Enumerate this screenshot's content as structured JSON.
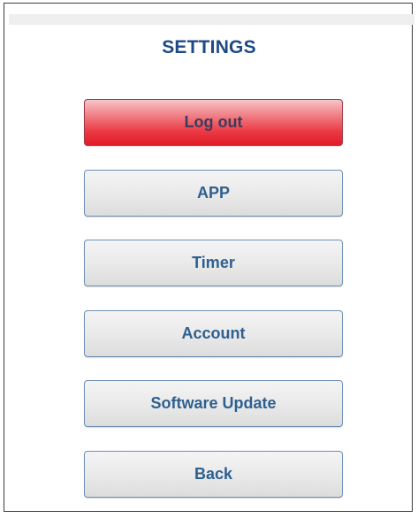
{
  "header": {
    "title": "SETTINGS"
  },
  "menu": {
    "items": [
      {
        "label": "Log out"
      },
      {
        "label": "APP"
      },
      {
        "label": "Timer"
      },
      {
        "label": "Account"
      },
      {
        "label": "Software Update"
      },
      {
        "label": "Back"
      }
    ]
  },
  "colors": {
    "title": "#1d4a86",
    "button_text": "#2e5f8f",
    "logout_red": "#e11c28",
    "button_gray": "#e9e9e9"
  }
}
